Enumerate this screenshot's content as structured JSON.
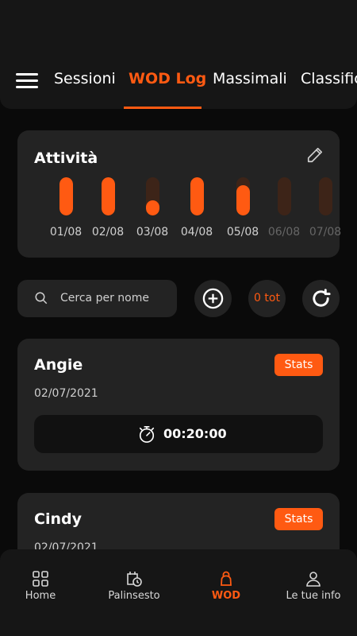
{
  "header": {
    "tabs": [
      {
        "label": "Sessioni"
      },
      {
        "label": "WOD Log"
      },
      {
        "label": "Massimali"
      },
      {
        "label": "Classifica"
      }
    ],
    "active_tab": "WOD Log"
  },
  "activity": {
    "title": "Attività",
    "days": [
      {
        "label": "01/08",
        "level": 1.0,
        "dim": false
      },
      {
        "label": "02/08",
        "level": 1.0,
        "dim": false
      },
      {
        "label": "03/08",
        "level": 0.4,
        "dim": false
      },
      {
        "label": "04/08",
        "level": 1.0,
        "dim": false
      },
      {
        "label": "05/08",
        "level": 0.8,
        "dim": false
      },
      {
        "label": "06/08",
        "level": 0.0,
        "dim": true
      },
      {
        "label": "07/08",
        "level": 0.0,
        "dim": true
      }
    ]
  },
  "search": {
    "placeholder": "Cerca per nome"
  },
  "counter": "0 tot",
  "wods": [
    {
      "name": "Angie",
      "stats_label": "Stats",
      "date": "02/07/2021",
      "time": "00:20:00"
    },
    {
      "name": "Cindy",
      "stats_label": "Stats",
      "date": "02/07/2021",
      "time": ""
    }
  ],
  "bottom_nav": [
    {
      "label": "Home",
      "icon": "grid-icon"
    },
    {
      "label": "Palinsesto",
      "icon": "calendar-icon"
    },
    {
      "label": "WOD",
      "icon": "kettlebell-icon"
    },
    {
      "label": "Le tue info",
      "icon": "person-icon"
    }
  ],
  "colors": {
    "accent": "#ff5a12",
    "card": "#232323",
    "background": "#0a0a0a"
  }
}
